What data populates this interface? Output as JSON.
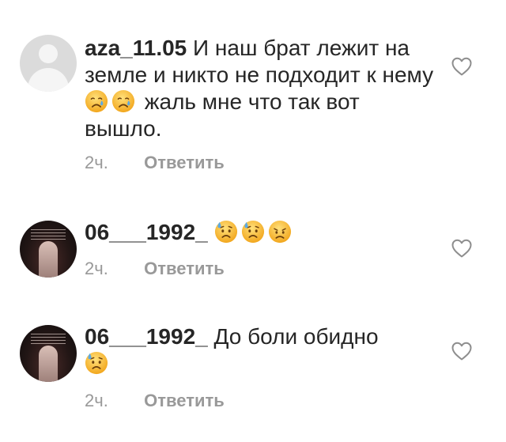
{
  "comments": [
    {
      "username": "aza_11.05",
      "text_before_emoji": "И наш брат лежит на земле и никто не подходит к нему",
      "text_after_emoji": "жаль мне что так вот вышло.",
      "time": "2ч.",
      "reply_label": "Ответить",
      "emoji_icons": [
        "crying-face-icon",
        "crying-face-icon"
      ]
    },
    {
      "username": "06___1992_",
      "text": "",
      "time": "2ч.",
      "reply_label": "Ответить",
      "emoji_icons": [
        "sad-but-relieved-face-icon",
        "sad-but-relieved-face-icon",
        "disappointed-face-icon"
      ]
    },
    {
      "username": "06___1992_",
      "text": "До боли обидно",
      "time": "2ч.",
      "reply_label": "Ответить",
      "emoji_icons": [
        "sad-but-relieved-face-icon"
      ]
    }
  ],
  "icons": {
    "like": "heart-outline-icon",
    "default_avatar": "default-avatar-icon"
  },
  "colors": {
    "text": "#262626",
    "secondary": "#999999",
    "emoji_face": "#f7c23b"
  }
}
